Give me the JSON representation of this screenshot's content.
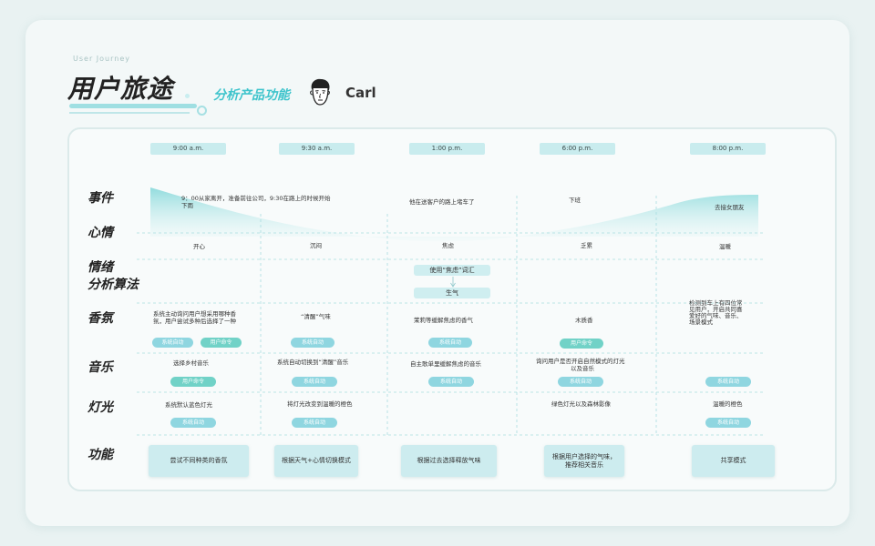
{
  "header": {
    "eyebrow": "User Journey",
    "title": "用户旅途",
    "subtitle": "分析产品功能",
    "persona_name": "Carl"
  },
  "times": [
    "9:00 a.m.",
    "9:30 a.m.",
    "1:00 p.m.",
    "6:00 p.m.",
    "8:00 p.m."
  ],
  "rows": {
    "event": "事件",
    "mood": "心情",
    "emotion_line1": "情绪",
    "emotion_line2": "分析算法",
    "scent": "香氛",
    "music": "音乐",
    "light": "灯光",
    "feature": "功能"
  },
  "events": {
    "c1_line1": "9：00从家离开，准备前往公司，9:30在路上的时候开始",
    "c1_line2": "下雨",
    "c3": "他在送客户的路上堵车了",
    "c4": "下班",
    "c5": "去接女朋友"
  },
  "moods": [
    "开心",
    "沉闷",
    "焦虑",
    "乏累",
    "温暖"
  ],
  "algorithm": {
    "step1": "使用“焦虑”词汇",
    "step2": "生气"
  },
  "scent": {
    "c1_line1": "系统主动询问用户想采用哪种香",
    "c1_line2": "氛，用户尝试多种后选择了一种",
    "c2": "“清醒”气味",
    "c3": "茉莉等缓解焦虑的香气",
    "c4": "木质香",
    "c5_line1": "检测到车上有四位常",
    "c5_line2": "见用户，开启共同喜",
    "c5_line3": "爱好的气味、音乐、",
    "c5_line4": "场景模式"
  },
  "music": {
    "c1": "选择乡村音乐",
    "c2": "系统自动切换到“清醒”音乐",
    "c3": "自主歌单里缓解焦虑的音乐",
    "c4_line1": "询问用户是否开启自然模式的灯光",
    "c4_line2": "以及音乐"
  },
  "light": {
    "c1": "系统默认蓝色灯光",
    "c2": "将灯光改变到温暖的橙色",
    "c4": "绿色灯光以及森林影像",
    "c5": "温暖的橙色"
  },
  "tags": {
    "auto": "系统自动",
    "user_cmd": "用户命令",
    "user_cmd2": "用户命令"
  },
  "features": {
    "c1": "尝试不同种类的香氛",
    "c2": "根据天气+心情切换模式",
    "c3": "根据过去选择释放气味",
    "c4_line1": "根据用户选择的气味，",
    "c4_line2": "推荐相关音乐",
    "c5": "共享模式"
  },
  "colors": {
    "accent": "#3fc4cc",
    "tag": "#8fd6e0",
    "tag_user": "#71d2c7",
    "box": "#cdecef",
    "wave": "#7fd6d8"
  }
}
